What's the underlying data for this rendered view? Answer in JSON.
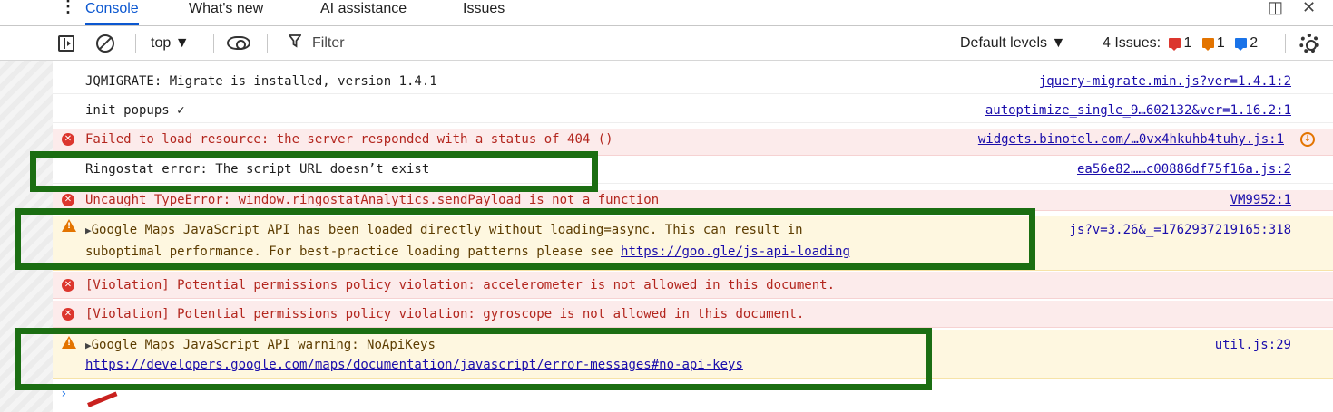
{
  "tabs": {
    "menu_glyph": "⋮",
    "items": [
      {
        "label": "Console",
        "active": true
      },
      {
        "label": "What's new",
        "active": false
      },
      {
        "label": "AI assistance",
        "active": false
      },
      {
        "label": "Issues",
        "active": false
      }
    ],
    "dock_glyph": "◫",
    "close_glyph": "✕"
  },
  "toolbar": {
    "context": "top ▼",
    "filter_placeholder": "Filter",
    "filter_glyph": "Y",
    "levels": "Default levels ▼",
    "issues_label": "4 Issues:",
    "issues_error_count": "1",
    "issues_warning_count": "1",
    "issues_info_count": "2"
  },
  "colors": {
    "accent": "#0b57d0",
    "error_bg": "#fcebeb",
    "warning_bg": "#fef7e0",
    "annotation": "#1b6e12"
  },
  "console": {
    "rows": [
      {
        "level": "log",
        "message": "JQMIGRATE: Migrate is installed, version 1.4.1",
        "source": "jquery-migrate.min.js?ver=1.4.1:2"
      },
      {
        "level": "log",
        "message": "init popups ✓",
        "source": "autoptimize_single_9…602132&ver=1.16.2:1"
      },
      {
        "level": "error",
        "message": "Failed to load resource: the server responded with a status of 404 ()",
        "source": "widgets.binotel.com/…0vx4hkuhb4tuhy.js:1"
      },
      {
        "level": "log",
        "message": "Ringostat error: The script URL doesn’t exist",
        "source": "ea56e82……c00886df75f16a.js:2"
      },
      {
        "level": "error",
        "message": "Uncaught TypeError: window.ringostatAnalytics.sendPayload is not a function",
        "source": "VM9952:1"
      },
      {
        "level": "warning",
        "message_line1": "Google Maps JavaScript API has been loaded directly without loading=async. This can result in",
        "message_line2": "suboptimal performance. For best-practice loading patterns please see ",
        "link": "https://goo.gle/js-api-loading",
        "source": "js?v=3.26&_=1762937219165:318"
      },
      {
        "level": "error",
        "message": "[Violation] Potential permissions policy violation: accelerometer is not allowed in this document."
      },
      {
        "level": "error",
        "message": "[Violation] Potential permissions policy violation: gyroscope is not allowed in this document."
      },
      {
        "level": "warning",
        "message_line1": "Google Maps JavaScript API warning: NoApiKeys",
        "link": "https://developers.google.com/maps/documentation/javascript/error-messages#no-api-keys",
        "source": "util.js:29"
      }
    ],
    "prompt": "›"
  }
}
